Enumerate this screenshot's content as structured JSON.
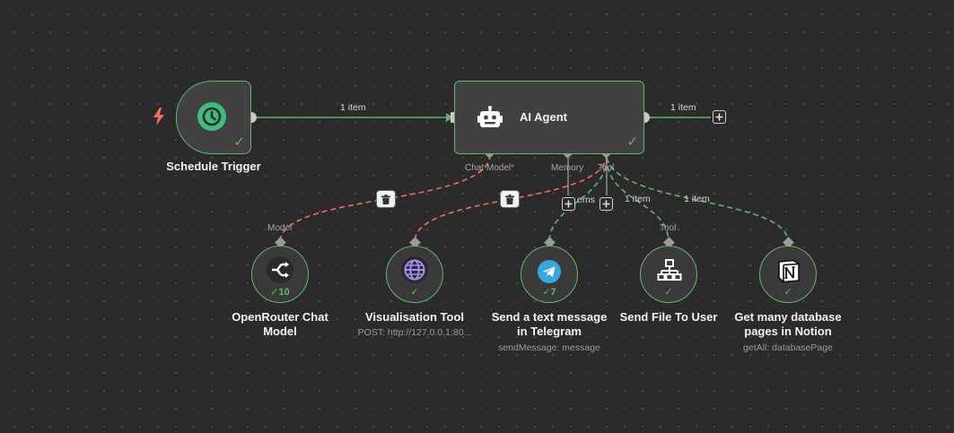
{
  "colors": {
    "canvas": "#2b2b2b",
    "node_bg": "#414141",
    "success": "#5db76a",
    "error_edge": "#ef6c5c",
    "trigger_icon_bg": "#3dbd7d"
  },
  "nodes": {
    "schedule_trigger": {
      "title": "Schedule Trigger",
      "icon": "clock-icon",
      "status": "success"
    },
    "ai_agent": {
      "title": "AI Agent",
      "icon": "robot-icon",
      "status": "success",
      "ports": {
        "chat_model": "Chat Model",
        "chat_model_required": "*",
        "memory": "Memory",
        "tool": "Tool"
      }
    },
    "openrouter": {
      "title": "OpenRouter Chat Model",
      "title_line1": "OpenRouter Chat",
      "title_line2": "Model",
      "port_label": "Model",
      "badge": "10",
      "icon": "openrouter-icon"
    },
    "visualisation": {
      "title": "Visualisation Tool",
      "subtitle": "POST: http://127.0.0.1:80...",
      "icon": "globe-icon"
    },
    "telegram": {
      "title_line1": "Send a text message",
      "title_line2": "in Telegram",
      "subtitle": "sendMessage: message",
      "badge": "7",
      "icon": "telegram-icon"
    },
    "send_file": {
      "title": "Send File To User",
      "port_label": "Tool",
      "icon": "network-icon"
    },
    "notion": {
      "title_line1": "Get many database",
      "title_line2": "pages in Notion",
      "subtitle": "getAll: databasePage",
      "icon": "notion-icon"
    }
  },
  "edges": {
    "trigger_to_agent": "1 item",
    "agent_output": "1 item",
    "tool_items_partial": "ems",
    "tool_send_file": "1 item",
    "tool_notion": "1 item"
  }
}
